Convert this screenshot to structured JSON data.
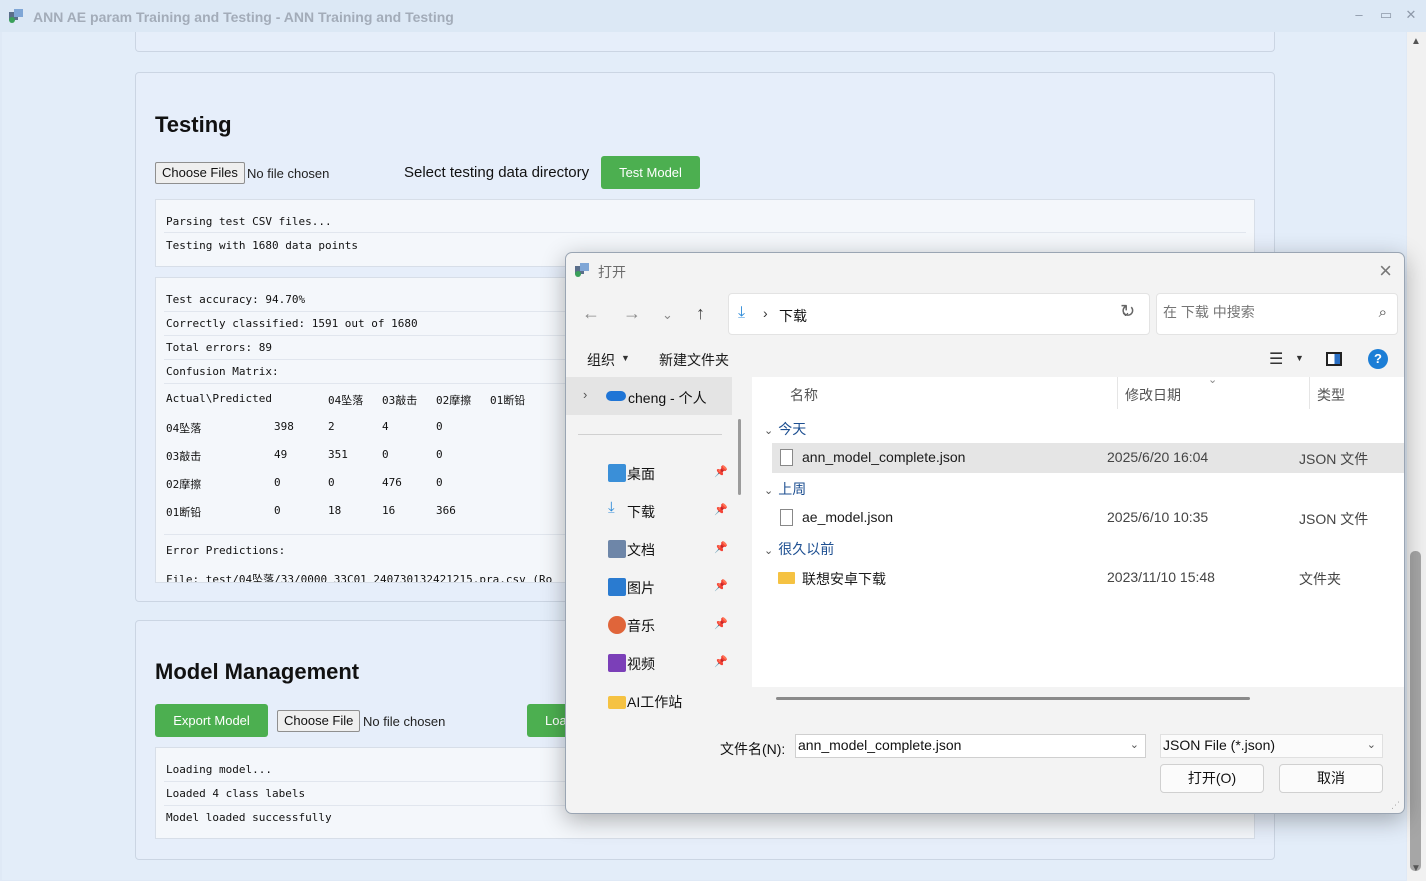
{
  "window": {
    "title": "ANN AE param Training and Testing - ANN Training and Testing",
    "minimize": "–",
    "maximize": "▭",
    "close": "✕"
  },
  "testing": {
    "heading": "Testing",
    "choose_files_label": "Choose Files",
    "no_file_text": "No file chosen",
    "directory_label": "Select testing data directory",
    "test_button": "Test Model",
    "log1": [
      "Parsing test CSV files...",
      "Testing with 1680 data points"
    ],
    "log2": {
      "lines": [
        "Test accuracy: 94.70%",
        "Correctly classified: 1591 out of 1680",
        "Total errors: 89",
        "Confusion Matrix:"
      ],
      "matrix_header": [
        "Actual\\Predicted",
        "04坠落",
        "03敲击",
        "02摩擦",
        "01断铅"
      ],
      "matrix_rows": [
        [
          "04坠落",
          "398",
          "2",
          "4",
          "0"
        ],
        [
          "03敲击",
          "49",
          "351",
          "0",
          "0"
        ],
        [
          "02摩擦",
          "0",
          "0",
          "476",
          "0"
        ],
        [
          "01断铅",
          "0",
          "18",
          "16",
          "366"
        ]
      ],
      "error_heading": "Error Predictions:",
      "error_line": "File: test/04坠落/33/0000_33C01_240730132421215.pra.csv (Ro"
    }
  },
  "model_mgmt": {
    "heading": "Model Management",
    "export_button": "Export Model",
    "choose_file_label": "Choose File",
    "no_file_text": "No file chosen",
    "load_button_partial": "Loa",
    "log": [
      "Loading model...",
      "Loaded 4 class labels",
      "Model loaded successfully"
    ]
  },
  "dialog": {
    "title": "打开",
    "address_current": "下载",
    "search_placeholder": "在 下载 中搜索",
    "toolbar": {
      "organize": "组织",
      "new_folder": "新建文件夹"
    },
    "nav": [
      {
        "label": "cheng - 个人",
        "icon": "onedrive-icon"
      },
      {
        "label": "桌面",
        "icon": "desktop-icon",
        "color": "#3a8fd8"
      },
      {
        "label": "下载",
        "icon": "download-icon",
        "color": "#2c8ad8"
      },
      {
        "label": "文档",
        "icon": "document-icon",
        "color": "#6e86a8"
      },
      {
        "label": "图片",
        "icon": "pictures-icon",
        "color": "#2a7bd0"
      },
      {
        "label": "音乐",
        "icon": "music-icon",
        "color": "#e0653a"
      },
      {
        "label": "视频",
        "icon": "video-icon",
        "color": "#7b3fb8"
      },
      {
        "label": "AI工作站",
        "icon": "folder-icon",
        "color": "#f5c242"
      }
    ],
    "columns": {
      "name": "名称",
      "date": "修改日期",
      "type": "类型"
    },
    "groups": [
      {
        "label": "今天",
        "files": [
          {
            "name": "ann_model_complete.json",
            "date": "2025/6/20 16:04",
            "type": "JSON 文件"
          }
        ]
      },
      {
        "label": "上周",
        "files": [
          {
            "name": "ae_model.json",
            "date": "2025/6/10 10:35",
            "type": "JSON 文件"
          }
        ]
      },
      {
        "label": "很久以前",
        "files": [
          {
            "name": "联想安卓下载",
            "date": "2023/11/10 15:48",
            "type": "文件夹"
          }
        ]
      }
    ],
    "filename_label": "文件名(N):",
    "filename_value": "ann_model_complete.json",
    "filetype_value": "JSON File (*.json)",
    "open_button": "打开(O)",
    "cancel_button": "取消"
  }
}
